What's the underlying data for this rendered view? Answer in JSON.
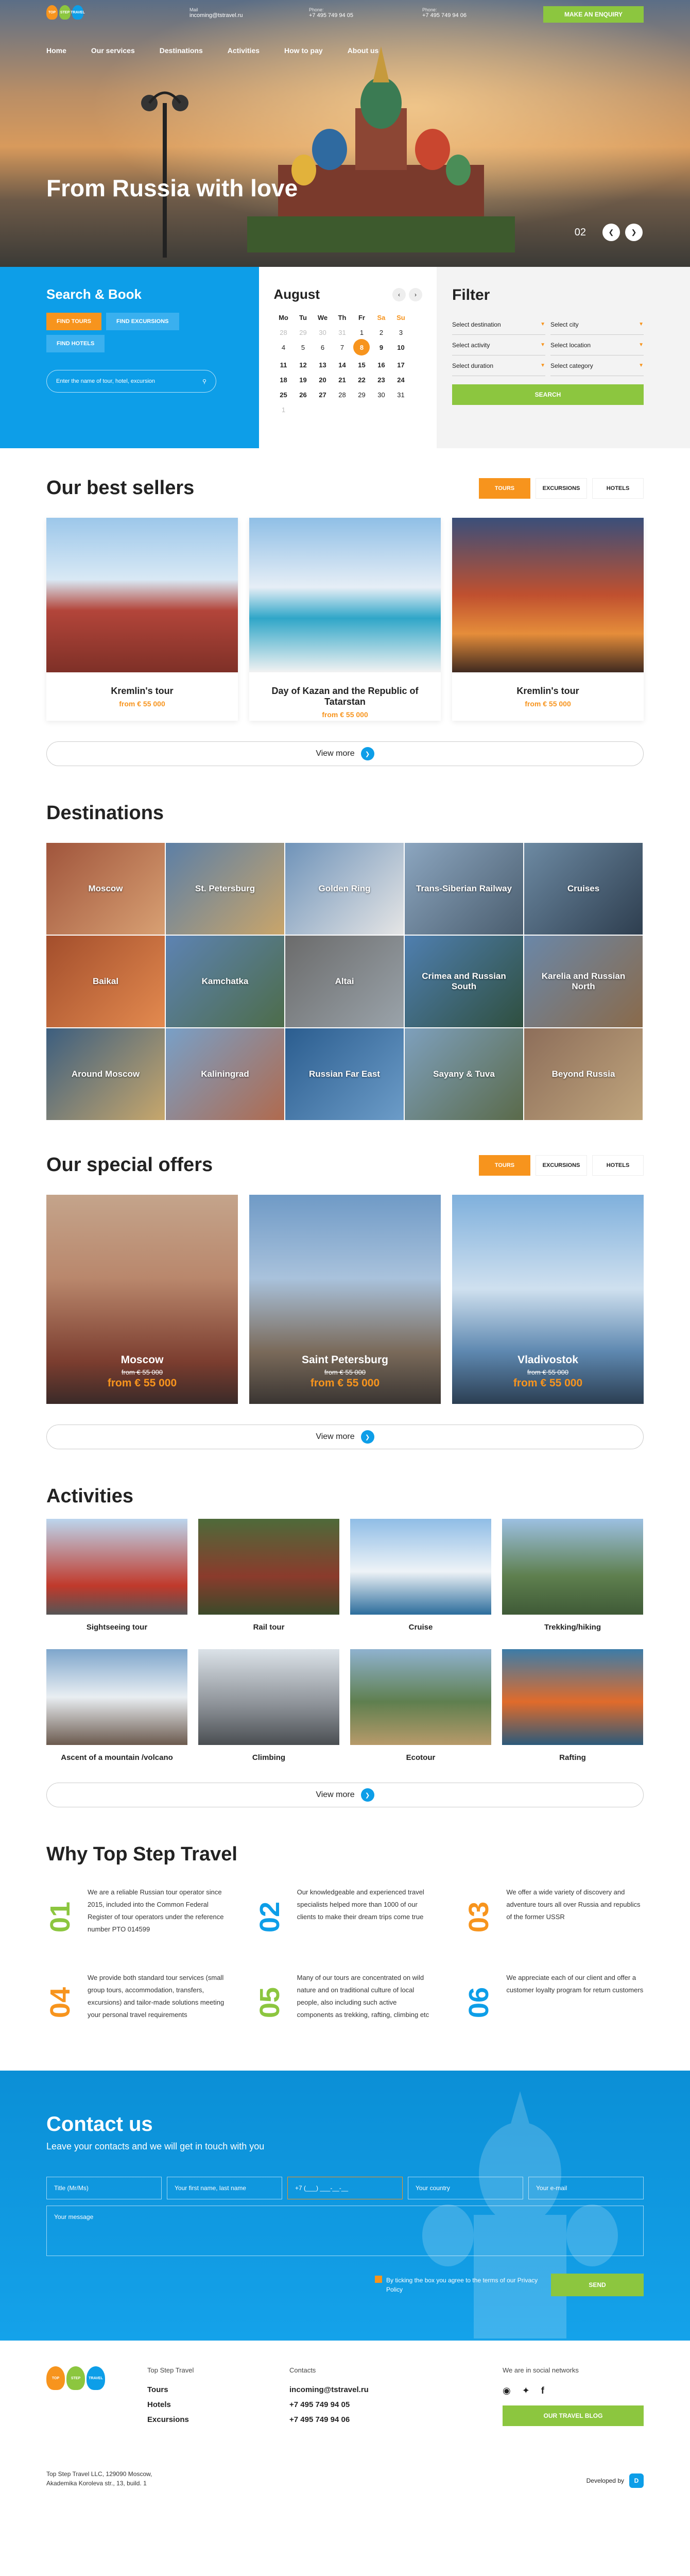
{
  "header": {
    "logo": [
      "TOP",
      "STEP",
      "TRAVEL"
    ],
    "mail_label": "Mail",
    "mail": "incoming@tstravel.ru",
    "phone1_label": "Phone:",
    "phone1": "+7 495 749 94 05",
    "phone2_label": "Phone:",
    "phone2": "+7 495 749 94 06",
    "enquiry": "MAKE AN ENQUIRY"
  },
  "nav": [
    "Home",
    "Our services",
    "Destinations",
    "Activities",
    "How to pay",
    "About us"
  ],
  "hero": {
    "title": "From Russia with love",
    "slide": "02"
  },
  "search": {
    "title": "Search & Book",
    "tabs": [
      "FIND TOURS",
      "FIND EXCURSIONS",
      "FIND HOTELS"
    ],
    "placeholder": "Enter the name of tour, hotel, excursion"
  },
  "calendar": {
    "month": "August",
    "weekdays": [
      "Mo",
      "Tu",
      "We",
      "Th",
      "Fr",
      "Sa",
      "Su"
    ],
    "days": [
      "28",
      "29",
      "30",
      "31",
      "1",
      "2",
      "3",
      "4",
      "5",
      "6",
      "7",
      "8",
      "9",
      "10",
      "11",
      "12",
      "13",
      "14",
      "15",
      "16",
      "17",
      "18",
      "19",
      "20",
      "21",
      "22",
      "23",
      "24",
      "25",
      "26",
      "27",
      "28",
      "29",
      "30",
      "31",
      "1"
    ],
    "selected": "8"
  },
  "filter": {
    "title": "Filter",
    "fields": [
      "Select destination",
      "Select city",
      "Select activity",
      "Select location",
      "Select duration",
      "Select category"
    ],
    "search": "SEARCH"
  },
  "bestsellers": {
    "title": "Our best sellers",
    "tabs": [
      "TOURS",
      "EXCURSIONS",
      "HOTELS"
    ],
    "cards": [
      {
        "title": "Kremlin's tour",
        "price": "from € 55 000"
      },
      {
        "title": "Day of Kazan and the Republic of Tatarstan",
        "price": "from € 55 000"
      },
      {
        "title": "Kremlin's tour",
        "price": "from € 55 000"
      }
    ],
    "view_more": "View more"
  },
  "destinations": {
    "title": "Destinations",
    "items": [
      "Moscow",
      "St. Petersburg",
      "Golden Ring",
      "Trans-Siberian Railway",
      "Cruises",
      "Baikal",
      "Kamchatka",
      "Altai",
      "Crimea and Russian South",
      "Karelia and Russian North",
      "Around Moscow",
      "Kaliningrad",
      "Russian Far East",
      "Sayany & Tuva",
      "Beyond Russia"
    ]
  },
  "offers": {
    "title": "Our special offers",
    "tabs": [
      "TOURS",
      "EXCURSIONS",
      "HOTELS"
    ],
    "cards": [
      {
        "title": "Moscow",
        "old": "from € 55 000",
        "price": "from € 55 000"
      },
      {
        "title": "Saint Petersburg",
        "old": "from € 55 000",
        "price": "from € 55 000"
      },
      {
        "title": "Vladivostok",
        "old": "from € 55 000",
        "price": "from € 55 000"
      }
    ],
    "view_more": "View more"
  },
  "activities": {
    "title": "Activities",
    "items": [
      "Sightseeing tour",
      "Rail tour",
      "Cruise",
      "Trekking/hiking",
      "Ascent of a mountain /volcano",
      "Climbing",
      "Ecotour",
      "Rafting"
    ],
    "view_more": "View more"
  },
  "why": {
    "title": "Why Top Step Travel",
    "items": [
      {
        "num": "01",
        "text": "We are a reliable Russian tour operator since 2015, included into the Common Federal Register of tour operators under the reference number PTO 014599"
      },
      {
        "num": "02",
        "text": "Our knowledgeable and experienced travel specialists helped more than 1000 of our clients to make their dream trips come true"
      },
      {
        "num": "03",
        "text": "We offer a wide variety of discovery and adventure tours all over Russia and republics of the former USSR"
      },
      {
        "num": "04",
        "text": "We provide both standard tour services (small group tours, accommodation, transfers, excursions) and tailor-made solutions meeting your personal travel requirements"
      },
      {
        "num": "05",
        "text": "Many of our tours are concentrated on wild nature and on traditional culture of local people, also including such active components as trekking, rafting, climbing etc"
      },
      {
        "num": "06",
        "text": "We appreciate each of our client and offer a customer loyalty program for return customers"
      }
    ]
  },
  "contact": {
    "title": "Contact us",
    "subtitle": "Leave your contacts and we will get in touch with you",
    "fields": [
      "Title (Mr/Ms)",
      "Your first name, last name",
      "+7 (___) ___-__-__",
      "Your country",
      "Your e-mail"
    ],
    "message": "Your message",
    "agree": "By ticking the box you agree to the terms of our Privacy Policy",
    "send": "SEND"
  },
  "footer": {
    "col1_title": "Top Step Travel",
    "links": [
      "Tours",
      "Hotels",
      "Excursions"
    ],
    "col2_title": "Contacts",
    "mail": "incoming@tstravel.ru",
    "phone1": "+7 495 749 94 05",
    "phone2": "+7 495 749 94 06",
    "col3_title": "We are in social networks",
    "social": [
      "instagram",
      "twitter",
      "facebook"
    ],
    "blog": "OUR TRAVEL BLOG",
    "address1": "Top Step Travel LLC, 129090 Moscow,",
    "address2": "Akademika Koroleva str., 13, build. 1",
    "developed": "Developed by"
  },
  "colors": {
    "orange": "#f7941d",
    "blue": "#0d9ee8",
    "green": "#8cc63f"
  }
}
